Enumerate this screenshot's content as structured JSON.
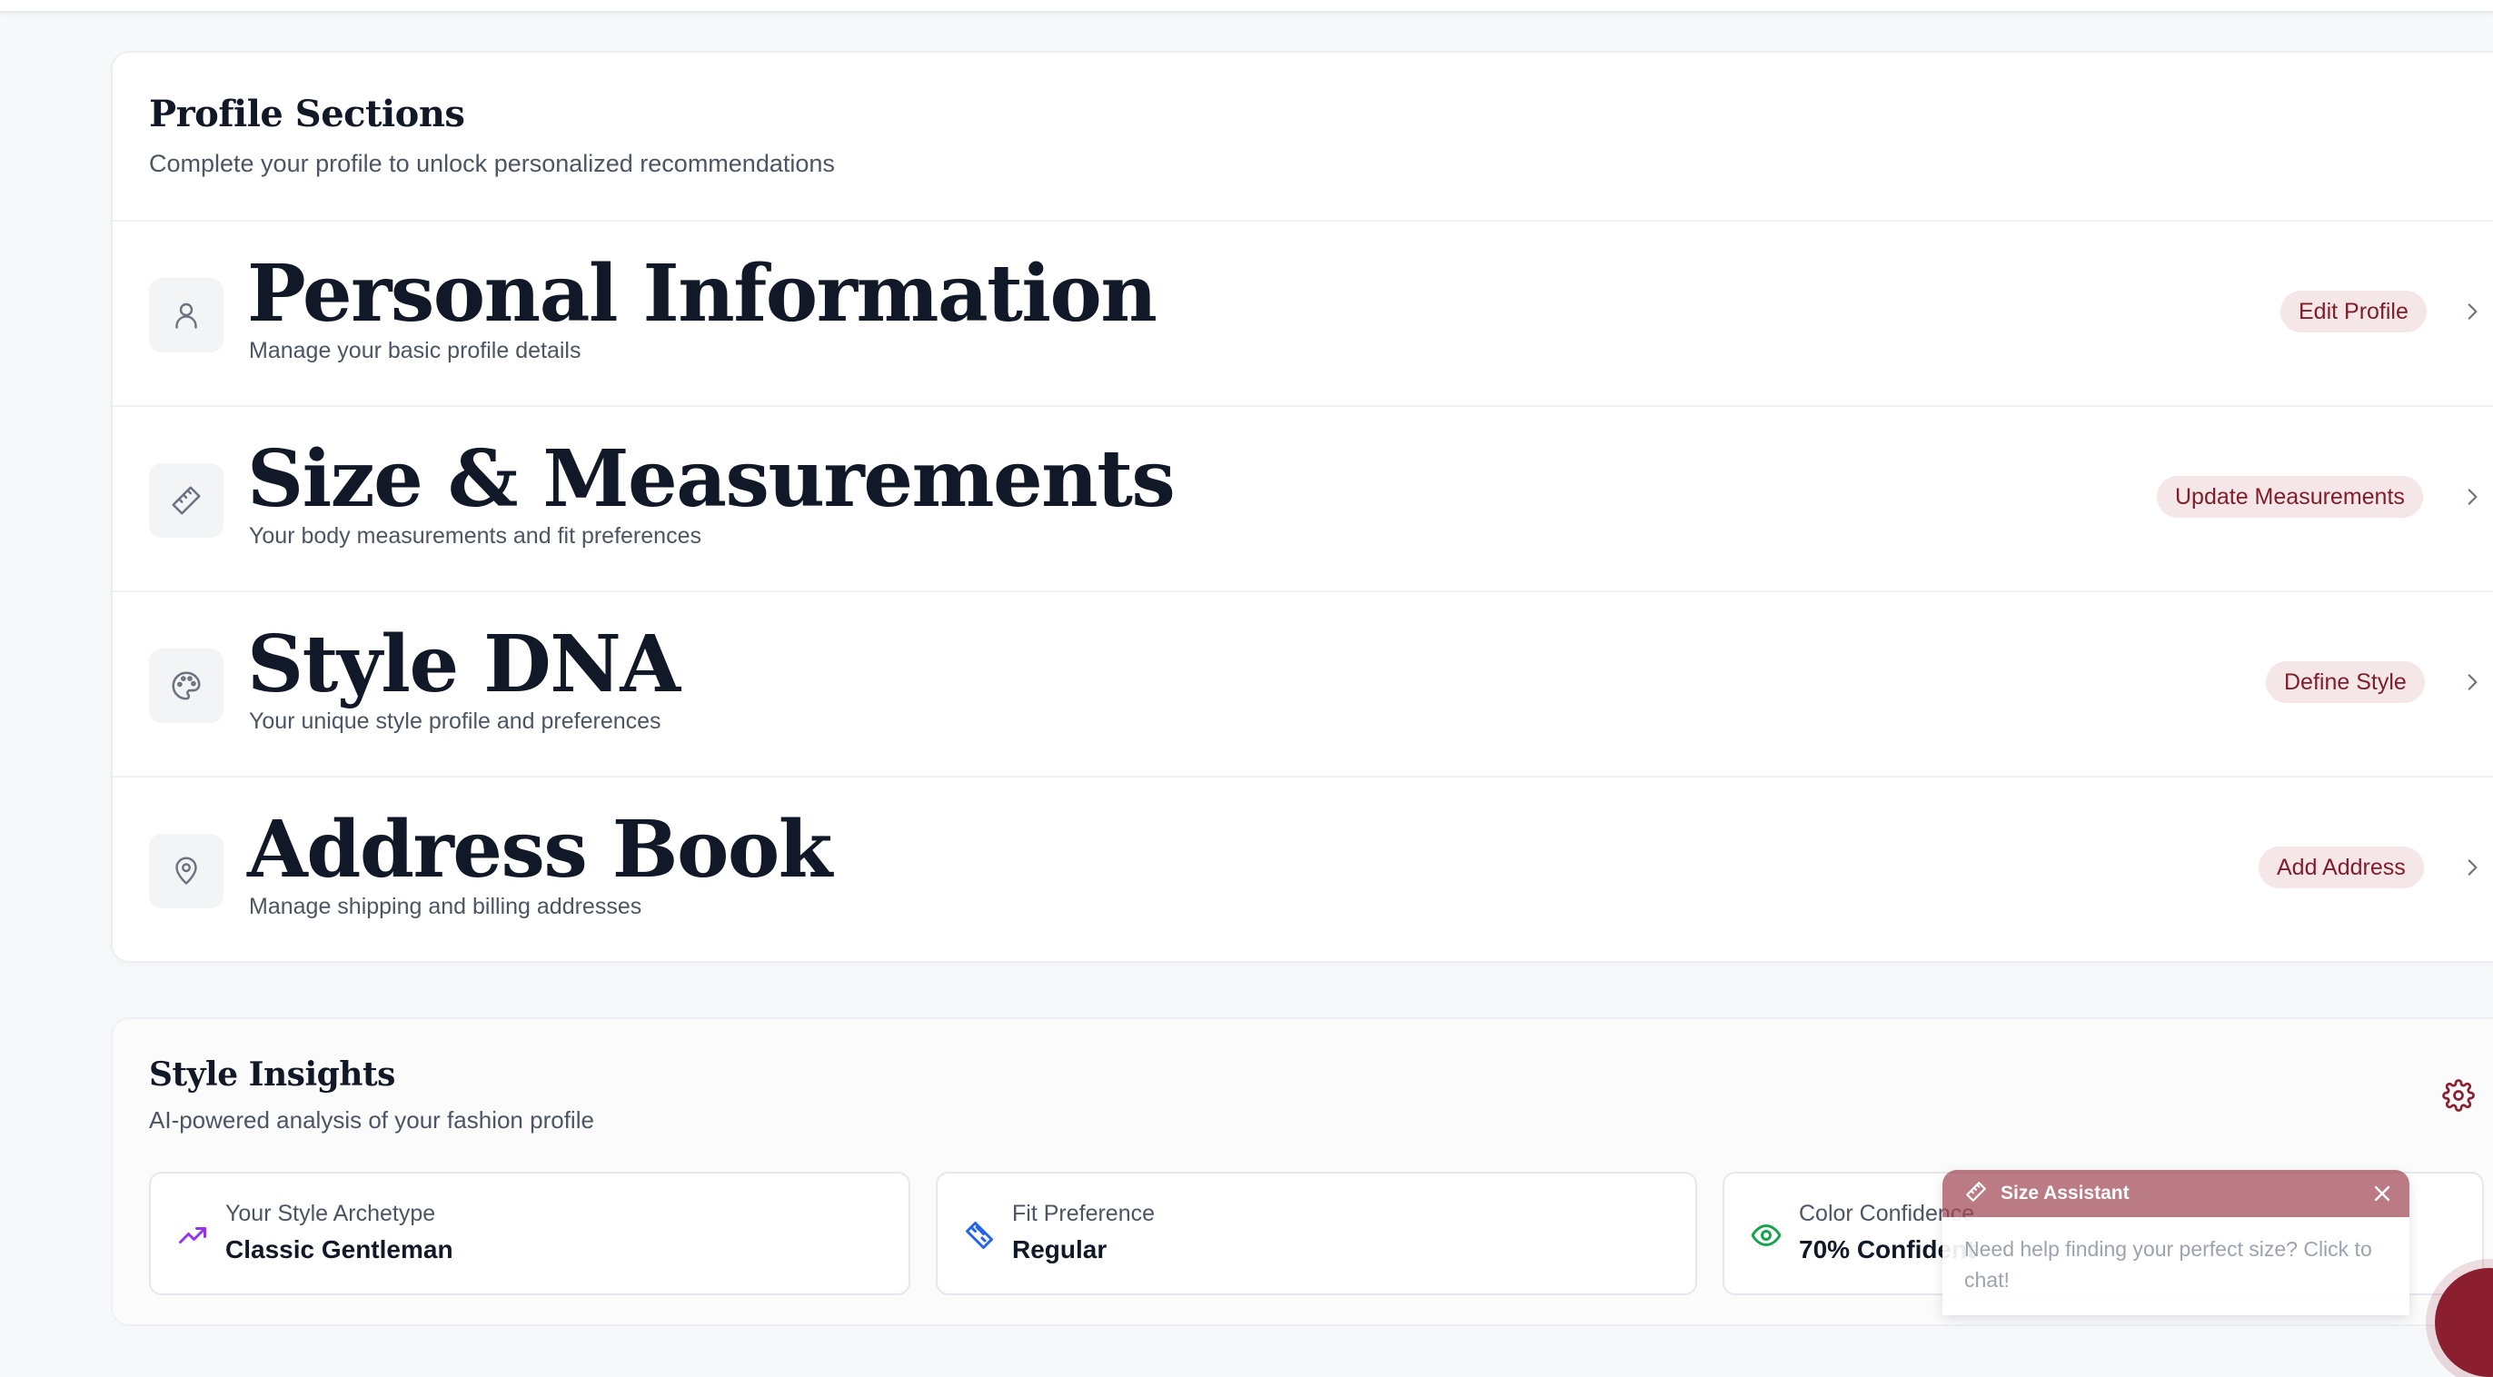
{
  "profile_sections": {
    "title": "Profile Sections",
    "subtitle": "Complete your profile to unlock personalized recommendations",
    "rows": [
      {
        "title": "Personal Information",
        "description": "Manage your basic profile details",
        "action": "Edit Profile",
        "icon": "user-icon"
      },
      {
        "title": "Size & Measurements",
        "description": "Your body measurements and fit preferences",
        "action": "Update Measurements",
        "icon": "ruler-icon"
      },
      {
        "title": "Style DNA",
        "description": "Your unique style profile and preferences",
        "action": "Define Style",
        "icon": "palette-icon"
      },
      {
        "title": "Address Book",
        "description": "Manage shipping and billing addresses",
        "action": "Add Address",
        "icon": "map-pin-icon"
      }
    ]
  },
  "style_insights": {
    "title": "Style Insights",
    "subtitle": "AI-powered analysis of your fashion profile",
    "settings_icon": "gear-icon",
    "cards": [
      {
        "label": "Your Style Archetype",
        "value": "Classic Gentleman",
        "icon": "trending-up-icon",
        "color": "#9333ea"
      },
      {
        "label": "Fit Preference",
        "value": "Regular",
        "icon": "ruler-icon",
        "color": "#2563eb"
      },
      {
        "label": "Color Confidence",
        "value": "70% Confident",
        "icon": "eye-icon",
        "color": "#16a34a"
      }
    ]
  },
  "size_assistant": {
    "title": "Size Assistant",
    "message": "Need help finding your perfect size? Click to chat!"
  },
  "colors": {
    "accent": "#7f1d2a",
    "accent_soft": "#f5e6e8",
    "background": "#f7f8fa"
  }
}
